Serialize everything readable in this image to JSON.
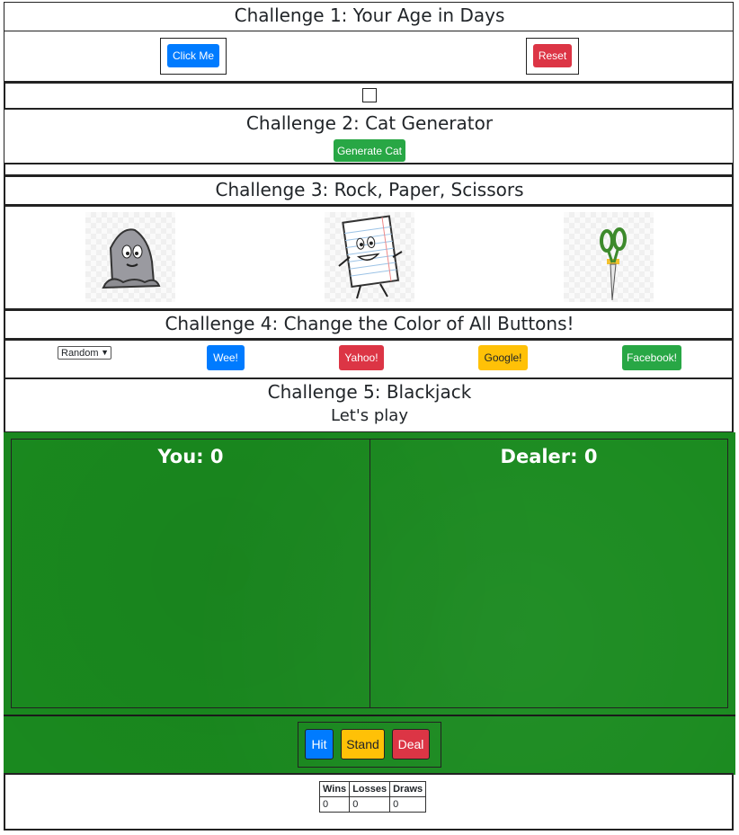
{
  "c1": {
    "title": "Challenge 1: Your Age in Days",
    "click_label": "Click Me",
    "reset_label": "Reset"
  },
  "c2": {
    "title": "Challenge 2: Cat Generator",
    "button_label": "Generate Cat"
  },
  "c3": {
    "title": "Challenge 3: Rock, Paper, Scissors",
    "choices": [
      "rock",
      "paper",
      "scissors"
    ]
  },
  "c4": {
    "title": "Challenge 4: Change the Color of All Buttons!",
    "select_value": "Random",
    "buttons": [
      "Wee!",
      "Yahoo!",
      "Google!",
      "Facebook!"
    ]
  },
  "c5": {
    "title": "Challenge 5: Blackjack",
    "subtitle": "Let's play",
    "you_label": "You: 0",
    "dealer_label": "Dealer: 0",
    "hit_label": "Hit",
    "stand_label": "Stand",
    "deal_label": "Deal",
    "table": {
      "headers": [
        "Wins",
        "Losses",
        "Draws"
      ],
      "values": [
        "0",
        "0",
        "0"
      ]
    }
  },
  "colors": {
    "blue": "#007bff",
    "red": "#dc3545",
    "green": "#28a745",
    "yellow": "#ffc107",
    "felt": "#1a8a1f"
  }
}
